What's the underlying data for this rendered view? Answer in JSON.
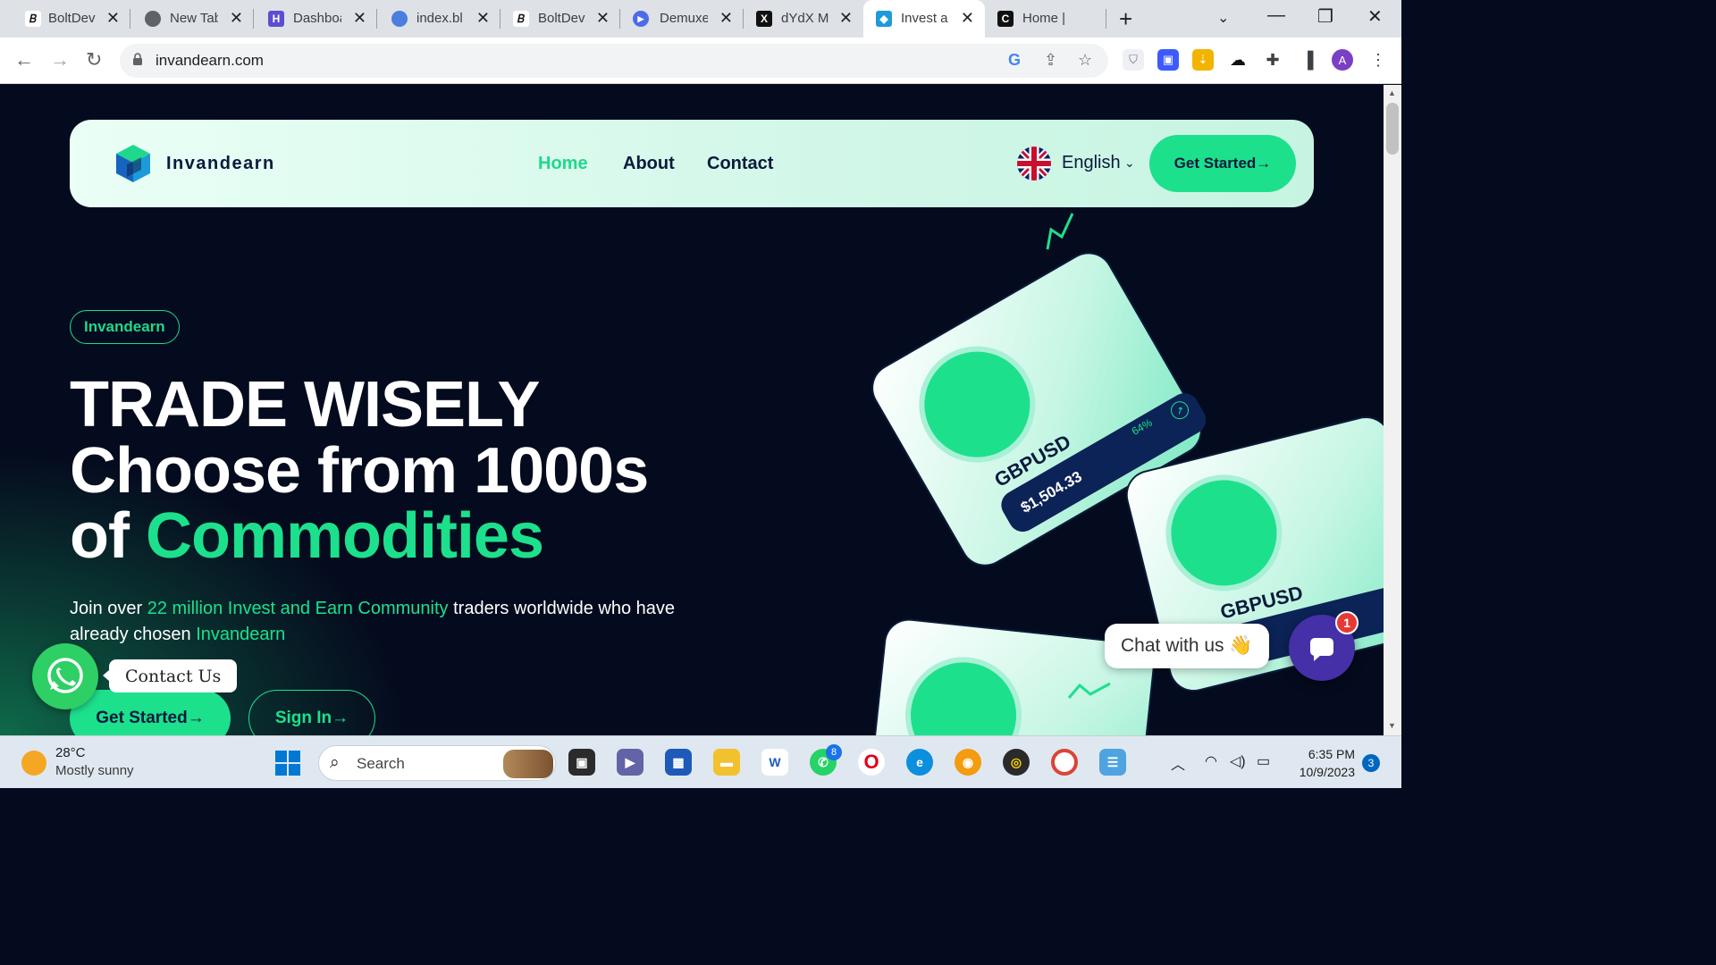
{
  "browser": {
    "tabs": [
      {
        "label": "BoltDev",
        "icon": "boltdev-icon",
        "color": "#1b1b1b",
        "glyph": "B"
      },
      {
        "label": "New Tab",
        "icon": "chrome-icon",
        "color": "#5f6368",
        "glyph": "◎"
      },
      {
        "label": "Dashboard",
        "icon": "dashboard-icon",
        "color": "#5b4fcf",
        "glyph": "H"
      },
      {
        "label": "index.bl",
        "icon": "globe-icon",
        "color": "#4a7fe0",
        "glyph": "◉"
      },
      {
        "label": "BoltDev",
        "icon": "boltdev-icon",
        "color": "#1b1b1b",
        "glyph": "B"
      },
      {
        "label": "Demuxe",
        "icon": "demuxe-icon",
        "color": "#4d6be8",
        "glyph": "▶"
      },
      {
        "label": "dYdX M",
        "icon": "dydx-icon",
        "color": "#111111",
        "glyph": "X"
      },
      {
        "label": "Invest a",
        "icon": "invandearn-icon",
        "color": "#1d9bd8",
        "glyph": "◆"
      },
      {
        "label": "Home |",
        "icon": "c-icon",
        "color": "#111111",
        "glyph": "C"
      }
    ],
    "url": "invandearn.com"
  },
  "site": {
    "brand": "Invandearn",
    "nav": {
      "home": "Home",
      "about": "About",
      "contact": "Contact"
    },
    "language": "English",
    "nav_cta": "Get Started→",
    "pill": "Invandearn",
    "headline": {
      "line1": "TRADE WISELY",
      "line2": "Choose from 1000s",
      "line3_prefix": "of ",
      "line3_accent": "Commodities"
    },
    "sub": {
      "part1": "Join over ",
      "accent1": "22 million Invest and Earn Community",
      "part2": " traders worldwide who have already chosen ",
      "accent2": "Invandearn"
    },
    "btn_get_started": "Get Started→",
    "btn_sign_in": "Sign In→",
    "cards": [
      {
        "pair": "GBPUSD",
        "price": "$1,504.33",
        "pct": "64%"
      },
      {
        "pair": "GBPUSD",
        "price": "",
        "pct": ""
      }
    ],
    "whatsapp_label": "Contact Us",
    "chat_label": "Chat with us 👋",
    "chat_badge": "1",
    "colors": {
      "accent": "#1de08d",
      "navy": "#0b1a3d",
      "background": "#050b1e"
    }
  },
  "taskbar": {
    "temp": "28°C",
    "condition": "Mostly sunny",
    "search": "Search",
    "whatsapp_badge": "8",
    "time": "6:35 PM",
    "date": "10/9/2023",
    "notifications": "3"
  }
}
